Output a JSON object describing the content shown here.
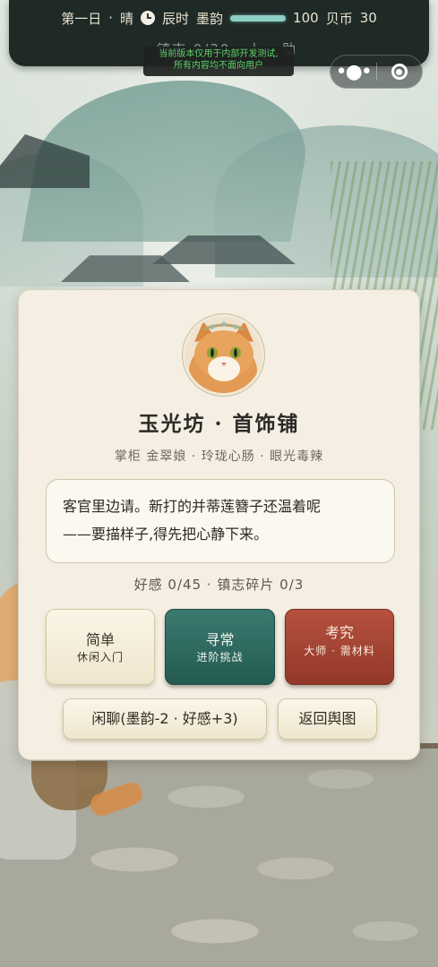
{
  "hud": {
    "day": "第一日",
    "separator": "·",
    "weather": "晴",
    "time": "辰时",
    "ink_label": "墨韵",
    "ink_value": "100",
    "ink_fraction": 1.0,
    "coin_label": "贝币",
    "coin_value": "30",
    "sub_text": "镇志 0/30 · 卜 · 助"
  },
  "dev_notice": {
    "line1": "当前版本仅用于内部开发测试,",
    "line2": "所有内容均不面向用户"
  },
  "capsule": {
    "more_icon": "more-dots-icon",
    "close_icon": "target-circle-icon"
  },
  "shop": {
    "title": "玉光坊 · 首饰铺",
    "subtitle": "掌柜 金翠娘 · 玲珑心肠 · 眼光毒辣",
    "dialog_line1": "客官里边请。新打的并蒂莲簪子还温着呢",
    "dialog_line2": "——要描样子,得先把心静下来。",
    "stats": "好感 0/45 · 镇志碎片 0/3"
  },
  "buttons": {
    "simple_title": "简单",
    "simple_sub": "休闲入门",
    "normal_title": "寻常",
    "normal_sub": "进阶挑战",
    "hard_title": "考究",
    "hard_sub": "大师 · 需材料",
    "chat": "闲聊(墨韵-2 · 好感+3)",
    "back": "返回舆图"
  },
  "colors": {
    "hud_bg": "#1f2a27",
    "card_bg": "#f4efe2",
    "normal_btn": "#2e6b62",
    "hard_btn": "#a3442f",
    "dev_text": "#5fd16d"
  }
}
